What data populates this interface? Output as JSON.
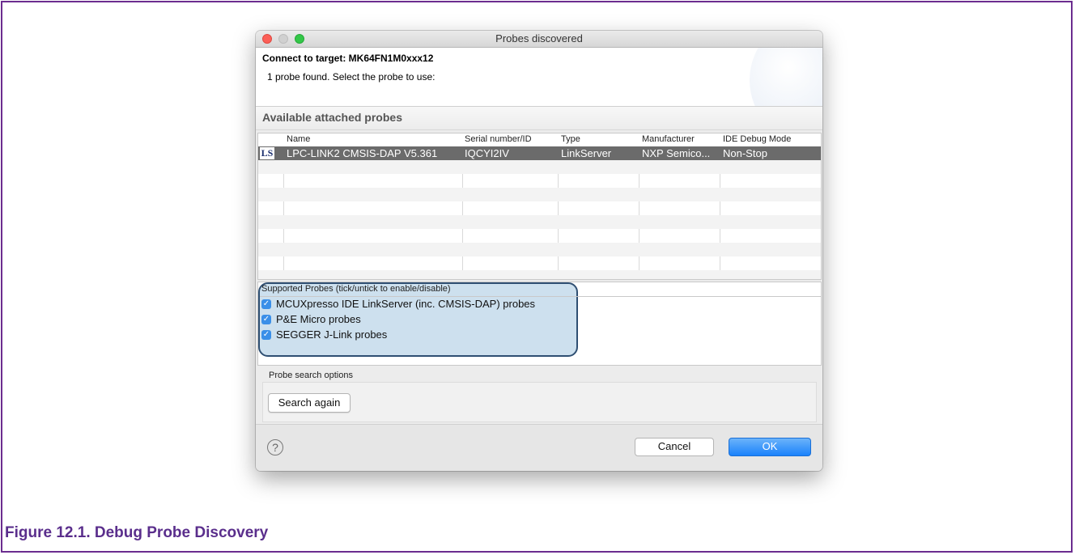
{
  "window": {
    "title": "Probes discovered"
  },
  "banner": {
    "connect_title": "Connect to target: MK64FN1M0xxx12",
    "message": "1 probe found. Select the probe to use:"
  },
  "probes_section": {
    "heading": "Available attached probes",
    "columns": [
      "Name",
      "Serial number/ID",
      "Type",
      "Manufacturer",
      "IDE Debug Mode"
    ],
    "rows": [
      {
        "icon": "LS",
        "name": "LPC-LINK2 CMSIS-DAP V5.361",
        "serial": "IQCYI2IV",
        "type": "LinkServer",
        "manufacturer": "NXP Semico...",
        "debug_mode": "Non-Stop",
        "selected": true
      }
    ]
  },
  "supported_probes": {
    "title": "Supported Probes (tick/untick to enable/disable)",
    "items": [
      {
        "label": "MCUXpresso IDE LinkServer (inc. CMSIS-DAP) probes",
        "checked": true
      },
      {
        "label": "P&E Micro probes",
        "checked": true
      },
      {
        "label": "SEGGER J-Link probes",
        "checked": true
      }
    ]
  },
  "search_options": {
    "label": "Probe search options",
    "search_again": "Search again"
  },
  "footer": {
    "help_glyph": "?",
    "cancel": "Cancel",
    "ok": "OK"
  },
  "caption": "Figure 12.1. Debug Probe Discovery",
  "colors": {
    "frame_border": "#6b2d8f",
    "caption": "#5a2e8c",
    "selection": "#6b6b6b",
    "highlight_fill": "#cde0ee",
    "highlight_border": "#2f4f72",
    "ok_button": "#1a82fb"
  }
}
